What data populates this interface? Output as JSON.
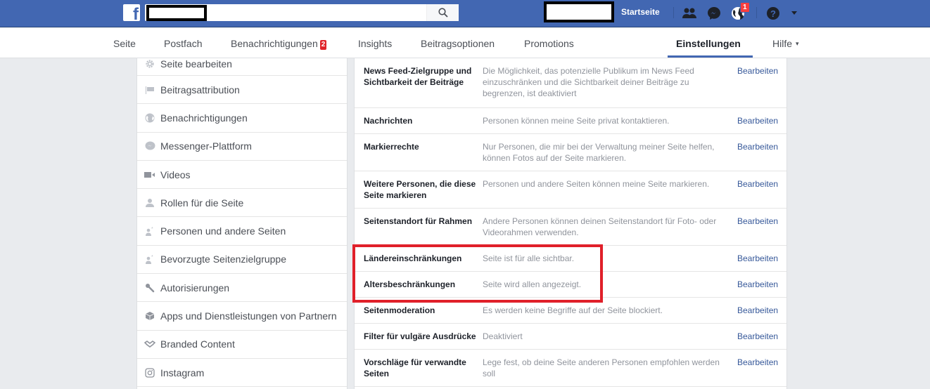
{
  "topbar": {
    "logo": "f",
    "search_placeholder": "",
    "home_label": "Startseite",
    "notifications_count": "1",
    "icons": [
      "friend-requests-icon",
      "messenger-icon",
      "globe-notifications-icon",
      "help-icon",
      "account-menu-caret-icon"
    ]
  },
  "subnav": {
    "tabs": [
      {
        "label": "Seite"
      },
      {
        "label": "Postfach"
      },
      {
        "label": "Benachrichtigungen",
        "badge": "2"
      },
      {
        "label": "Insights"
      },
      {
        "label": "Beitragsoptionen"
      },
      {
        "label": "Promotions"
      },
      {
        "label": "Einstellungen",
        "active": true
      },
      {
        "label": "Hilfe",
        "caret": "▾"
      }
    ]
  },
  "sidebar": {
    "items": [
      {
        "label": "Seite bearbeiten",
        "icon": "gear-icon"
      },
      {
        "label": "Beitragsattribution",
        "icon": "flag-icon"
      },
      {
        "label": "Benachrichtigungen",
        "icon": "globe-icon"
      },
      {
        "label": "Messenger-Plattform",
        "icon": "messenger-icon"
      },
      {
        "label": "Videos",
        "icon": "video-camera-icon"
      },
      {
        "label": "Rollen für die Seite",
        "icon": "person-icon"
      },
      {
        "label": "Personen und andere Seiten",
        "icon": "person-star-icon"
      },
      {
        "label": "Bevorzugte Seitenzielgruppe",
        "icon": "person-star-icon"
      },
      {
        "label": "Autorisierungen",
        "icon": "wrench-icon"
      },
      {
        "label": "Apps und Dienstleistungen von Partnern",
        "icon": "cube-icon"
      },
      {
        "label": "Branded Content",
        "icon": "handshake-icon"
      },
      {
        "label": "Instagram",
        "icon": "instagram-icon"
      }
    ]
  },
  "settings": {
    "edit_label": "Bearbeiten",
    "rows": [
      {
        "name": "News Feed-Zielgruppe und Sichtbarkeit der Beiträge",
        "desc": "Die Möglichkeit, das potenzielle Publikum im News Feed einzuschränken und die Sichtbarkeit deiner Beiträge zu begrenzen, ist deaktiviert"
      },
      {
        "name": "Nachrichten",
        "desc": "Personen können meine Seite privat kontaktieren."
      },
      {
        "name": "Markierrechte",
        "desc": "Nur Personen, die mir bei der Verwaltung meiner Seite helfen, können Fotos auf der Seite markieren."
      },
      {
        "name": "Weitere Personen, die diese Seite markieren",
        "desc": "Personen und andere Seiten können meine Seite markieren."
      },
      {
        "name": "Seitenstandort für Rahmen",
        "desc": "Andere Personen können deinen Seitenstandort für Foto- oder Videorahmen verwenden."
      },
      {
        "name": "Ländereinschränkungen",
        "desc": "Seite ist für alle sichtbar.",
        "highlighted": true
      },
      {
        "name": "Altersbeschränkungen",
        "desc": "Seite wird allen angezeigt.",
        "highlighted": true
      },
      {
        "name": "Seitenmoderation",
        "desc": "Es werden keine Begriffe auf der Seite blockiert."
      },
      {
        "name": "Filter für vulgäre Ausdrücke",
        "desc": "Deaktiviert"
      },
      {
        "name": "Vorschläge für verwandte Seiten",
        "desc": "Lege fest, ob deine Seite anderen Personen empfohlen werden soll"
      }
    ]
  },
  "colors": {
    "brand_blue": "#4267b2",
    "link_blue": "#365899",
    "badge_red": "#fa3e3e",
    "highlight_red": "#e0202a"
  }
}
